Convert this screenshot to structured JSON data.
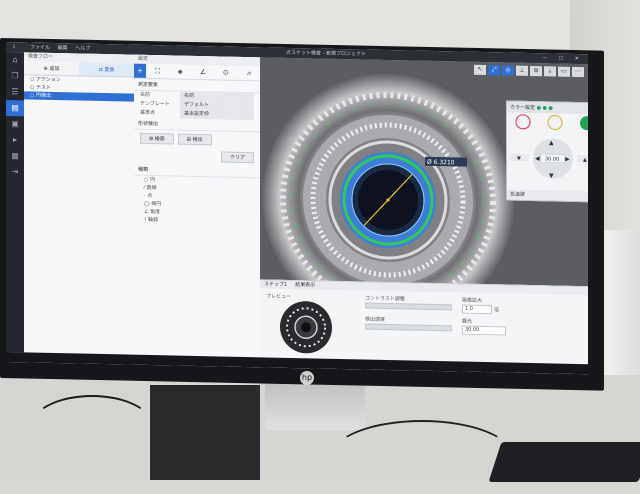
{
  "app": {
    "menu": [
      "ファイル",
      "編集",
      "ヘルプ"
    ],
    "title": "ガスケット検査 - 新規プロジェクト",
    "window_controls": "— ☐ ✕"
  },
  "leftbar_icons": [
    "download-icon",
    "folder-icon",
    "copy-icon",
    "list-icon",
    "document-icon",
    "image-icon",
    "play-icon",
    "table-icon",
    "export-icon"
  ],
  "panel1": {
    "header": "検査フロー",
    "tabs": [
      "追加",
      "変換"
    ],
    "items": [
      "アクション",
      "テスト",
      "円検出"
    ],
    "selected_index": 2
  },
  "panel2": {
    "header": "設定",
    "section_basic": "測定要素",
    "props": [
      {
        "k": "名前",
        "v": "名前"
      },
      {
        "k": "テンプレート",
        "v": "デフォルト"
      },
      {
        "k": "基準点",
        "v": "基本設定枠"
      }
    ],
    "section_region": "形状検出",
    "buttons": [
      "検索",
      "検出",
      "クリア"
    ],
    "section_list": "種類",
    "list": [
      "円",
      "直線",
      "点",
      "楕円",
      "角度",
      "輪郭"
    ]
  },
  "viewer": {
    "measure_label": "Ø 6.3210",
    "float_title": "カラー設定",
    "float_readout": "30.00",
    "float_footer": "色追跡",
    "float_colors": [
      "#e8495e",
      "#e0b84a",
      "#22a35a"
    ]
  },
  "bottom": {
    "tabs": [
      "ステップ1",
      "結果表示"
    ],
    "thumb_label": "プレビュー",
    "slider1_label": "コントラスト調整",
    "slider2_label": "検出感度",
    "field1_label": "画像拡大",
    "field1_value": "1.0",
    "field1_unit": "倍",
    "field2_label": "露光",
    "field2_value": "30.00"
  }
}
